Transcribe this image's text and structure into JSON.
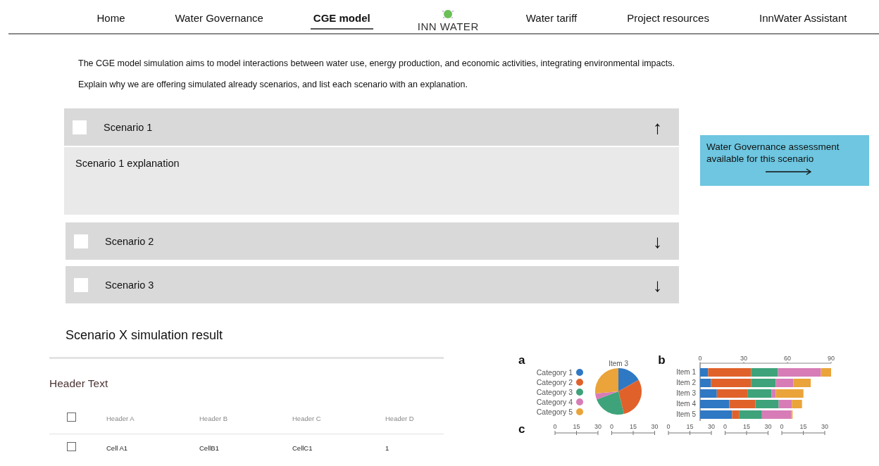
{
  "nav": {
    "items": [
      {
        "label": "Home",
        "selected": false
      },
      {
        "label": "Water Governance",
        "selected": false
      },
      {
        "label": "CGE model",
        "selected": true
      },
      {
        "kind": "logo",
        "label": "INN WATER"
      },
      {
        "label": "Water tariff",
        "selected": false
      },
      {
        "label": "Project resources",
        "selected": false
      },
      {
        "label": "InnWater Assistant",
        "selected": false
      }
    ]
  },
  "intro": [
    "The CGE model simulation aims to model interactions between water use, energy production, and economic activities, integrating environmental impacts.",
    "Explain why we are offering simulated already scenarios, and list each scenario with an explanation."
  ],
  "scenarios": [
    {
      "title": "Scenario 1",
      "checked": false,
      "expanded": true,
      "arrow": "↑",
      "explanation": "Scenario 1 explanation"
    },
    {
      "title": "Scenario 2",
      "checked": false,
      "expanded": false,
      "arrow": "↓"
    },
    {
      "title": "Scenario 3",
      "checked": false,
      "expanded": false,
      "arrow": "↓"
    }
  ],
  "governance_card": {
    "text": "Water Governance assessment available for this scenario"
  },
  "result_title": "Scenario X simulation result",
  "table": {
    "title": "Header Text",
    "columns": [
      "Header A",
      "Header B",
      "Header C",
      "Header D"
    ],
    "header_checked": false,
    "rows": [
      {
        "checked": false,
        "cells": [
          "Cell A1",
          "CellB1",
          "CellC1",
          "1"
        ]
      }
    ]
  },
  "figure": {
    "panels": [
      {
        "letter": "a",
        "legend": [
          {
            "label": "Category 1",
            "color": "#2f78c4"
          },
          {
            "label": "Category 2",
            "color": "#e0622a"
          },
          {
            "label": "Category 3",
            "color": "#3ea37a"
          },
          {
            "label": "Category 4",
            "color": "#d77cb7"
          },
          {
            "label": "Category 5",
            "color": "#eaa43a"
          }
        ],
        "chart_data": {
          "type": "pie",
          "title": "Item 3",
          "values": [
            16.8,
            29.4,
            23.1,
            4.2,
            26.5
          ]
        }
      },
      {
        "letter": "b",
        "chart_data": {
          "type": "bar",
          "orientation": "horizontal",
          "stacked": true,
          "categories": [
            "Item 1",
            "Item 2",
            "Item 3",
            "Item 4",
            "Item 5"
          ],
          "xlim": [
            0,
            90
          ],
          "xticks": [
            0,
            30,
            60,
            90
          ],
          "series": [
            {
              "color": "#2f78c4",
              "values": [
                5.5,
                7.5,
                11.5,
                20,
                22
              ]
            },
            {
              "color": "#e0622a",
              "values": [
                29.5,
                27.5,
                21,
                18,
                5
              ]
            },
            {
              "color": "#3ea37a",
              "values": [
                18.5,
                17,
                16.5,
                16,
                15.5
              ]
            },
            {
              "color": "#d77cb7",
              "values": [
                29.5,
                12,
                3,
                9,
                20
              ]
            },
            {
              "color": "#eaa43a",
              "values": [
                7,
                12,
                19,
                7,
                1
              ]
            }
          ]
        }
      },
      {
        "letter": "c",
        "axes": [
          {
            "ticks": [
              "0",
              "15",
              "30"
            ]
          },
          {
            "ticks": [
              "0",
              "15",
              "30"
            ]
          },
          {
            "ticks": [
              "0",
              "15",
              "30"
            ]
          },
          {
            "ticks": [
              "0",
              "15",
              "30"
            ]
          },
          {
            "ticks": [
              "0",
              "15",
              "30"
            ]
          }
        ]
      }
    ]
  }
}
